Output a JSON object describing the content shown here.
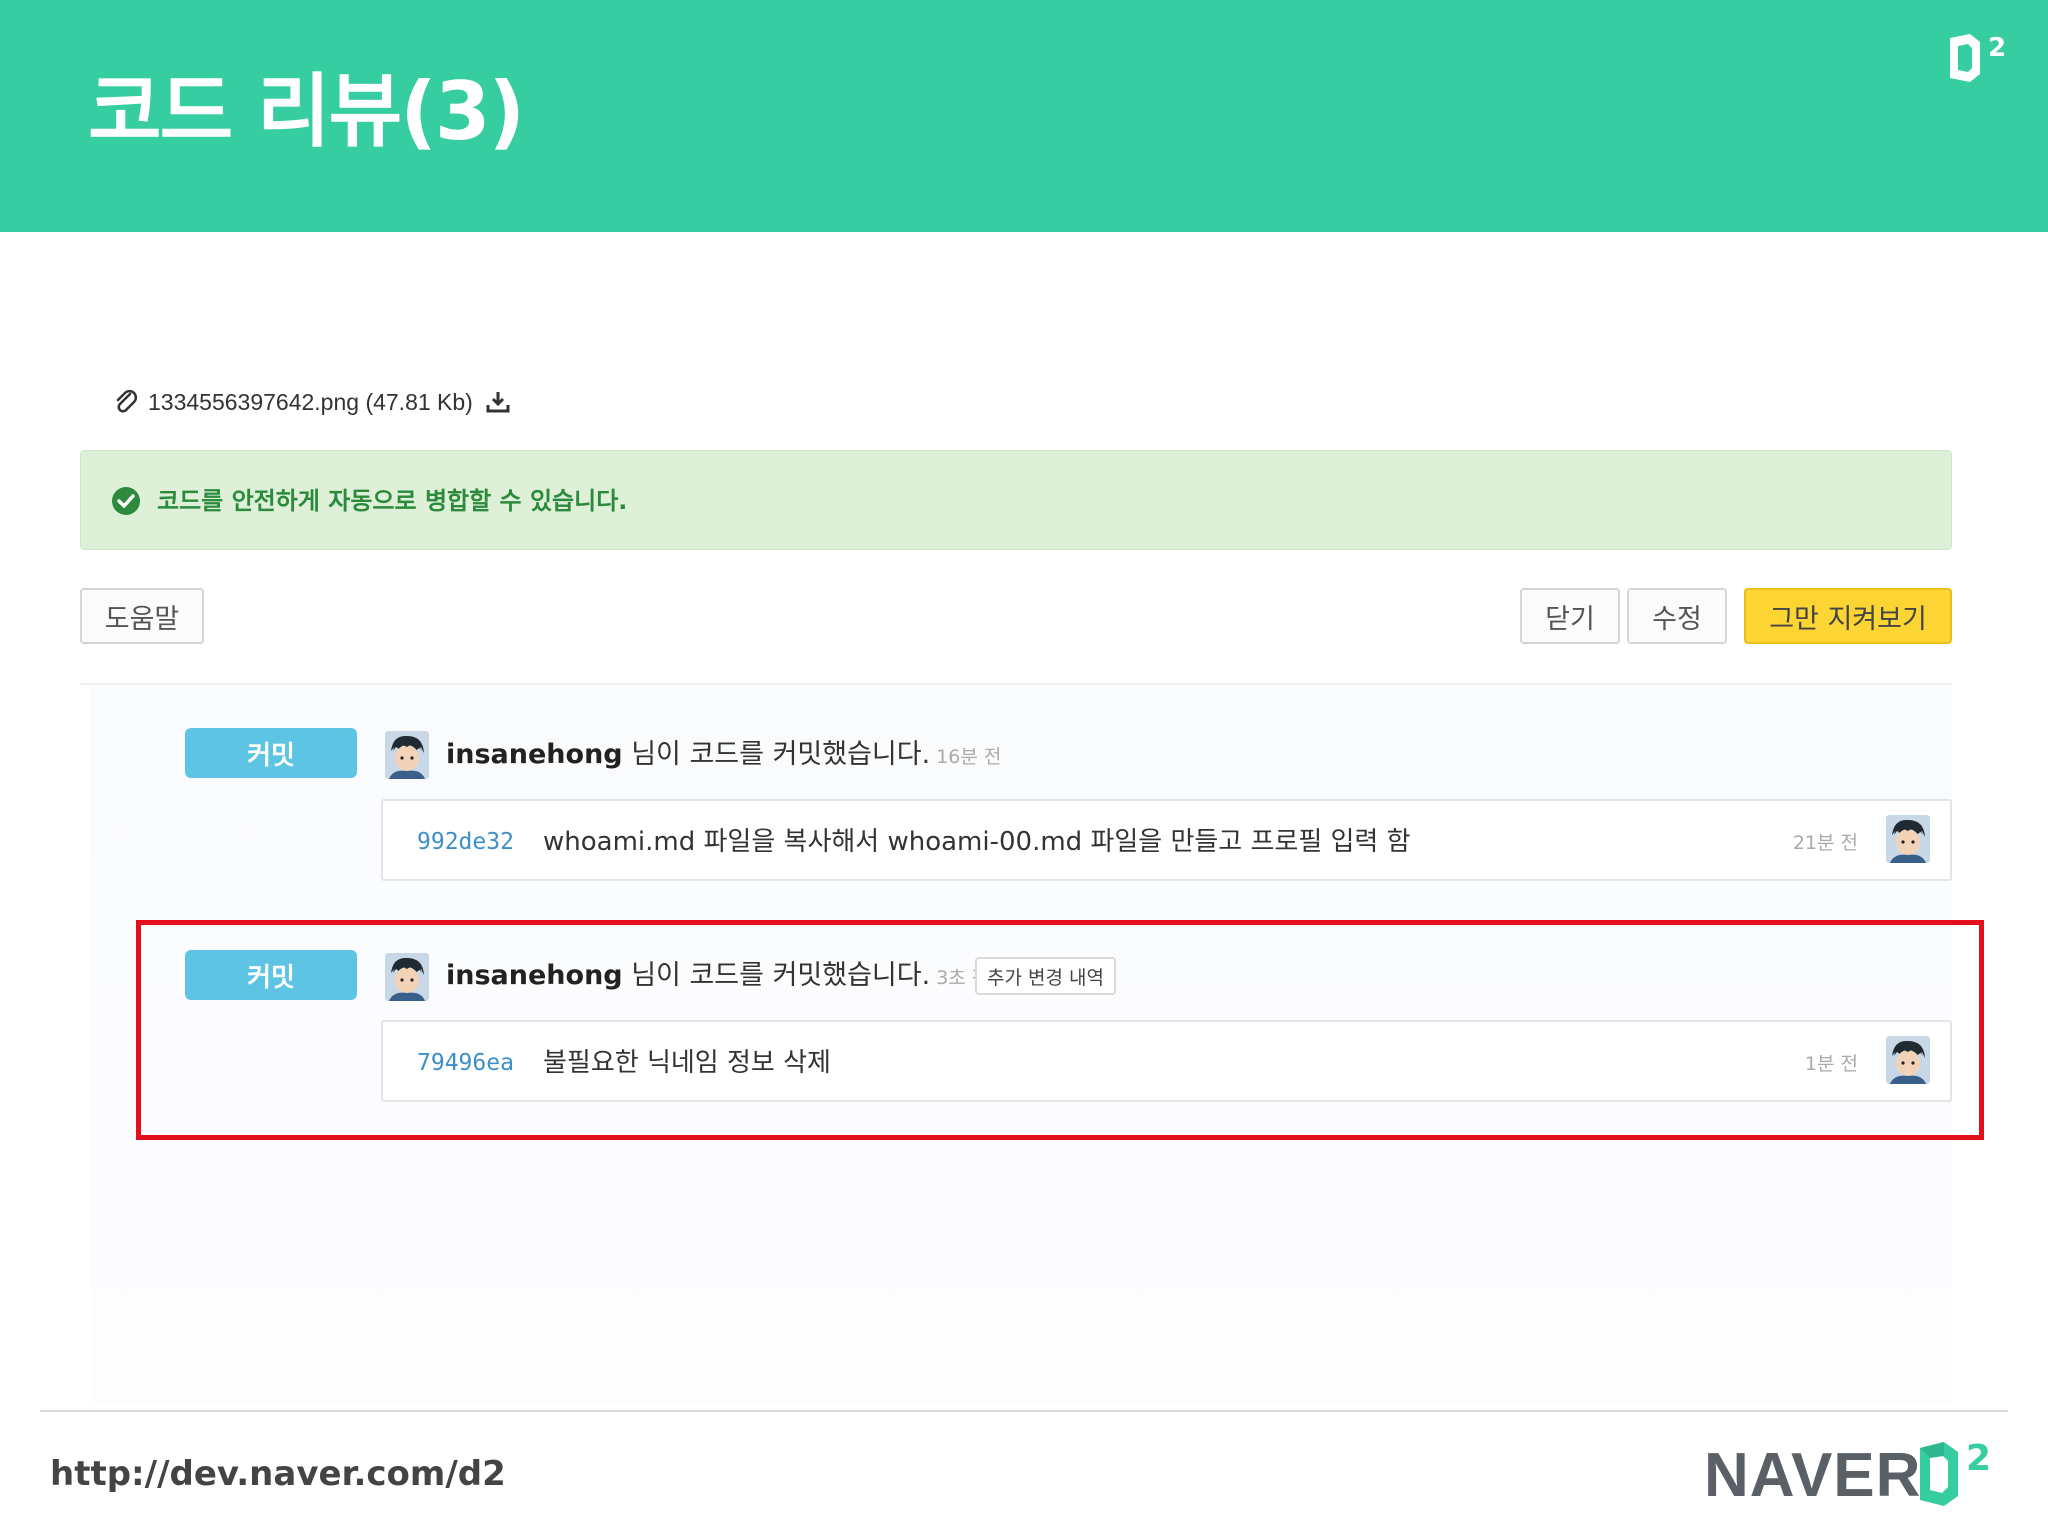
{
  "slide": {
    "title": "코드 리뷰(3)",
    "footer_url": "http://dev.naver.com/d2",
    "brand": "NAVER"
  },
  "attachment": {
    "filename": "1334556397642.png (47.81 Kb)"
  },
  "merge_status": {
    "message": "코드를 안전하게 자동으로 병합할 수 있습니다.",
    "color": "#2c8a3c"
  },
  "toolbar": {
    "help_label": "도움말",
    "close_label": "닫기",
    "edit_label": "수정",
    "unwatch_label": "그만 지켜보기"
  },
  "events": [
    {
      "label": "커밋",
      "user": "insanehong",
      "action": " 님이 코드를 커밋했습니다.",
      "ago": "16분 전",
      "commit": {
        "sha": "992de32",
        "message": "whoami.md 파일을 복사해서 whoami-00.md 파일을 만들고 프로필 입력 함",
        "time": "21분 전"
      }
    },
    {
      "label": "커밋",
      "user": "insanehong",
      "action": " 님이 코드를 커밋했습니다.",
      "ago": "3초 전",
      "extra_tag": "추가 변경 내역",
      "commit": {
        "sha": "79496ea",
        "message": "불필요한 닉네임 정보 삭제",
        "time": "1분 전"
      }
    }
  ],
  "colors": {
    "header": "#36cda0",
    "commit_label": "#5ec4e4",
    "unwatch_button": "#fcd535",
    "highlight_border": "#e3101c",
    "sha_link": "#3d8fc9"
  },
  "icons": [
    "d2-logo-icon",
    "paperclip-icon",
    "download-icon",
    "check-circle-icon",
    "avatar-image"
  ]
}
